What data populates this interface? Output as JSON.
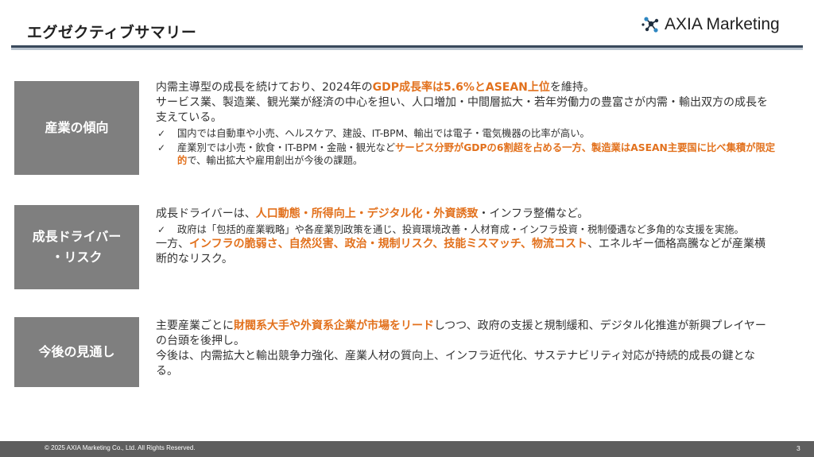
{
  "header": {
    "title": "エグゼクティブサマリー",
    "logo_text": "AXIA Marketing"
  },
  "sections": [
    {
      "label_line1": "産業の傾向",
      "label_line2": "",
      "lines": [
        {
          "a": "内需主導型の成長を続けており、2024年の",
          "b": "GDP成長率は5.6%とASEAN上位",
          "c": "を維持。"
        },
        {
          "a": "サービス業、製造業、観光業が経済の中心を担い、人口増加・中間層拡大・若年労働力の豊富さが内需・輸出双方の成長を支えている。",
          "b": "",
          "c": ""
        }
      ],
      "bullets": [
        {
          "a": "国内では自動車や小売、ヘルスケア、建設、IT-BPM、輸出では電子・電気機器の比率が高い。",
          "b": "",
          "c": ""
        },
        {
          "a": "産業別では小売・飲食・IT-BPM・金融・観光など",
          "b": "サービス分野がGDPの6割超を占める一方、製造業はASEAN主要国に比べ集積が限定的",
          "c": "で、輸出拡大や雇用創出が今後の課題。"
        }
      ]
    },
    {
      "label_line1": "成長ドライバー",
      "label_line2": "・リスク",
      "line1": {
        "a": "成長ドライバーは、",
        "b": "人口動態・所得向上・デジタル化・外資誘致",
        "c": "・インフラ整備など。"
      },
      "bullet": {
        "a": "政府は「包括的産業戦略」や各産業別政策を通じ、投資環境改善・人材育成・インフラ投資・税制優遇など多角的な支援を実施。"
      },
      "line2": {
        "a": "一方、",
        "b": "インフラの脆弱さ、自然災害、政治・規制リスク、技能ミスマッチ、物流コスト",
        "c": "、エネルギー価格高騰などが産業横断的なリスク。"
      }
    },
    {
      "label_line1": "今後の見通し",
      "label_line2": "",
      "lines": [
        {
          "a": "主要産業ごとに",
          "b": "財閥系大手や外資系企業が市場をリード",
          "c": "しつつ、政府の支援と規制緩和、デジタル化推進が新興プレイヤーの台頭を後押し。"
        },
        {
          "a": "今後は、内需拡大と輸出競争力強化、産業人材の質向上、インフラ近代化、サステナビリティ対応が持続的成長の鍵となる。",
          "b": "",
          "c": ""
        }
      ]
    }
  ],
  "footer": {
    "copyright": "© 2025 AXIA Marketing Co., Ltd. All Rights Reserved.",
    "page_number": "3"
  },
  "colors": {
    "accent": "#e2711d",
    "label_box": "#7f7f7f",
    "footer_bar": "#5e5e5e",
    "rule_dark": "#3a4a5c",
    "rule_light": "#b9c4cf"
  },
  "icons": {
    "logo": "molecule-logo-icon",
    "bullet": "check-icon"
  }
}
